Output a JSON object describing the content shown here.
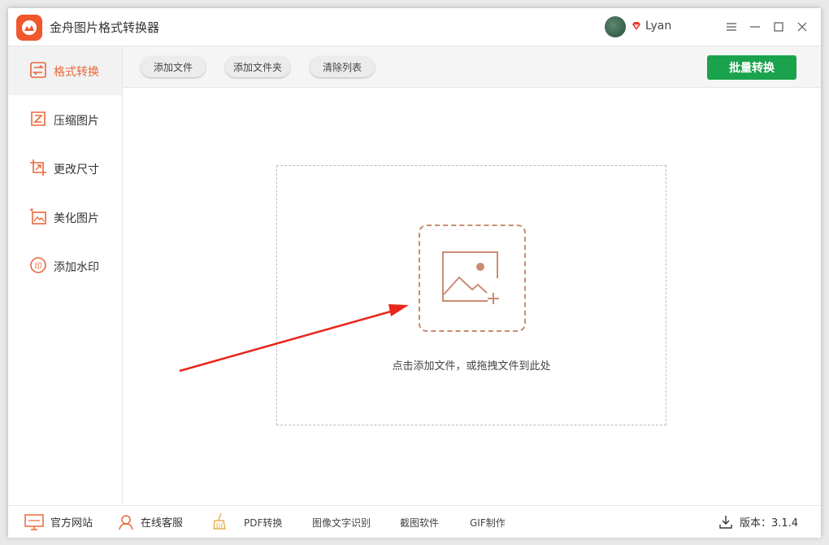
{
  "app": {
    "title": "金舟图片格式转换器"
  },
  "user": {
    "name": "Lyan"
  },
  "sidebar": {
    "items": [
      {
        "label": "格式转换",
        "icon": "convert-icon"
      },
      {
        "label": "压缩图片",
        "icon": "compress-icon"
      },
      {
        "label": "更改尺寸",
        "icon": "resize-icon"
      },
      {
        "label": "美化图片",
        "icon": "beautify-icon"
      },
      {
        "label": "添加水印",
        "icon": "watermark-icon"
      }
    ]
  },
  "toolbar": {
    "add_file": "添加文件",
    "add_folder": "添加文件夹",
    "clear_list": "清除列表",
    "batch_convert": "批量转换"
  },
  "main": {
    "drop_text": "点击添加文件，或拖拽文件到此处"
  },
  "footer": {
    "website": "官方网站",
    "support": "在线客服",
    "links": [
      "PDF转换",
      "图像文字识别",
      "截图软件",
      "GIF制作"
    ],
    "version_label": "版本：3.1.4"
  },
  "colors": {
    "accent": "#e8683a",
    "primary_green": "#1ba24c",
    "arrow_red": "#e8261c"
  }
}
